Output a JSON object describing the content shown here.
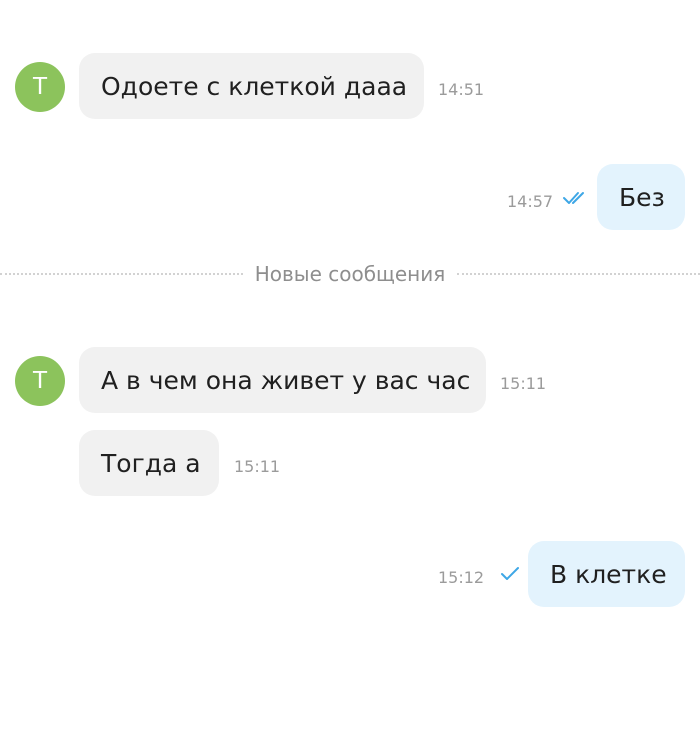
{
  "divider": {
    "label": "Новые сообщения"
  },
  "messages": [
    {
      "direction": "incoming",
      "avatar_letter": "Т",
      "text": "Одоете с клеткой дааа",
      "time": "14:51"
    },
    {
      "direction": "outgoing",
      "text": "Без",
      "time": "14:57",
      "status": "read"
    },
    {
      "direction": "incoming",
      "avatar_letter": "Т",
      "text": "А в чем она живет у вас час",
      "time": "15:11"
    },
    {
      "direction": "incoming",
      "text": "Тогда а",
      "time": "15:11"
    },
    {
      "direction": "outgoing",
      "text": "В клетке",
      "time": "15:12",
      "status": "sent"
    }
  ],
  "colors": {
    "avatar": "#8cc35c",
    "incoming_bubble": "#f1f1f1",
    "outgoing_bubble": "#e3f3fd",
    "check": "#3ea7e6",
    "timestamp": "#9b9b9b"
  },
  "icons": {
    "read_status": "double-check-icon",
    "sent_status": "single-check-icon"
  }
}
